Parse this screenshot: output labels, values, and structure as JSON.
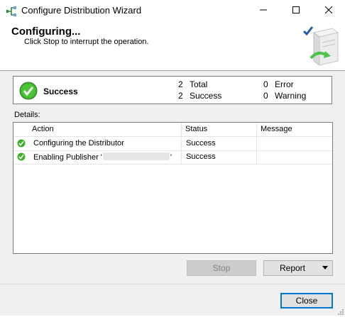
{
  "window": {
    "title": "Configure Distribution Wizard"
  },
  "header": {
    "title": "Configuring...",
    "subtitle": "Click Stop to interrupt the operation."
  },
  "summary": {
    "status": "Success",
    "total_count": "2",
    "total_label": "Total",
    "success_count": "2",
    "success_label": "Success",
    "error_count": "0",
    "error_label": "Error",
    "warning_count": "0",
    "warning_label": "Warning"
  },
  "details": {
    "label": "Details:",
    "columns": [
      "Action",
      "Status",
      "Message"
    ],
    "rows": [
      {
        "action": "Configuring the Distributor",
        "status": "Success",
        "message": ""
      },
      {
        "action_prefix": "Enabling Publisher '",
        "action_suffix": "'",
        "status": "Success",
        "message": ""
      }
    ]
  },
  "buttons": {
    "stop": "Stop",
    "report": "Report",
    "close": "Close"
  },
  "colors": {
    "success_green": "#3fae2a",
    "accent_blue": "#0078d7"
  },
  "icons": {
    "app": "wizard-icon",
    "status": "success-check-icon",
    "header_art": "server-check-icon"
  }
}
